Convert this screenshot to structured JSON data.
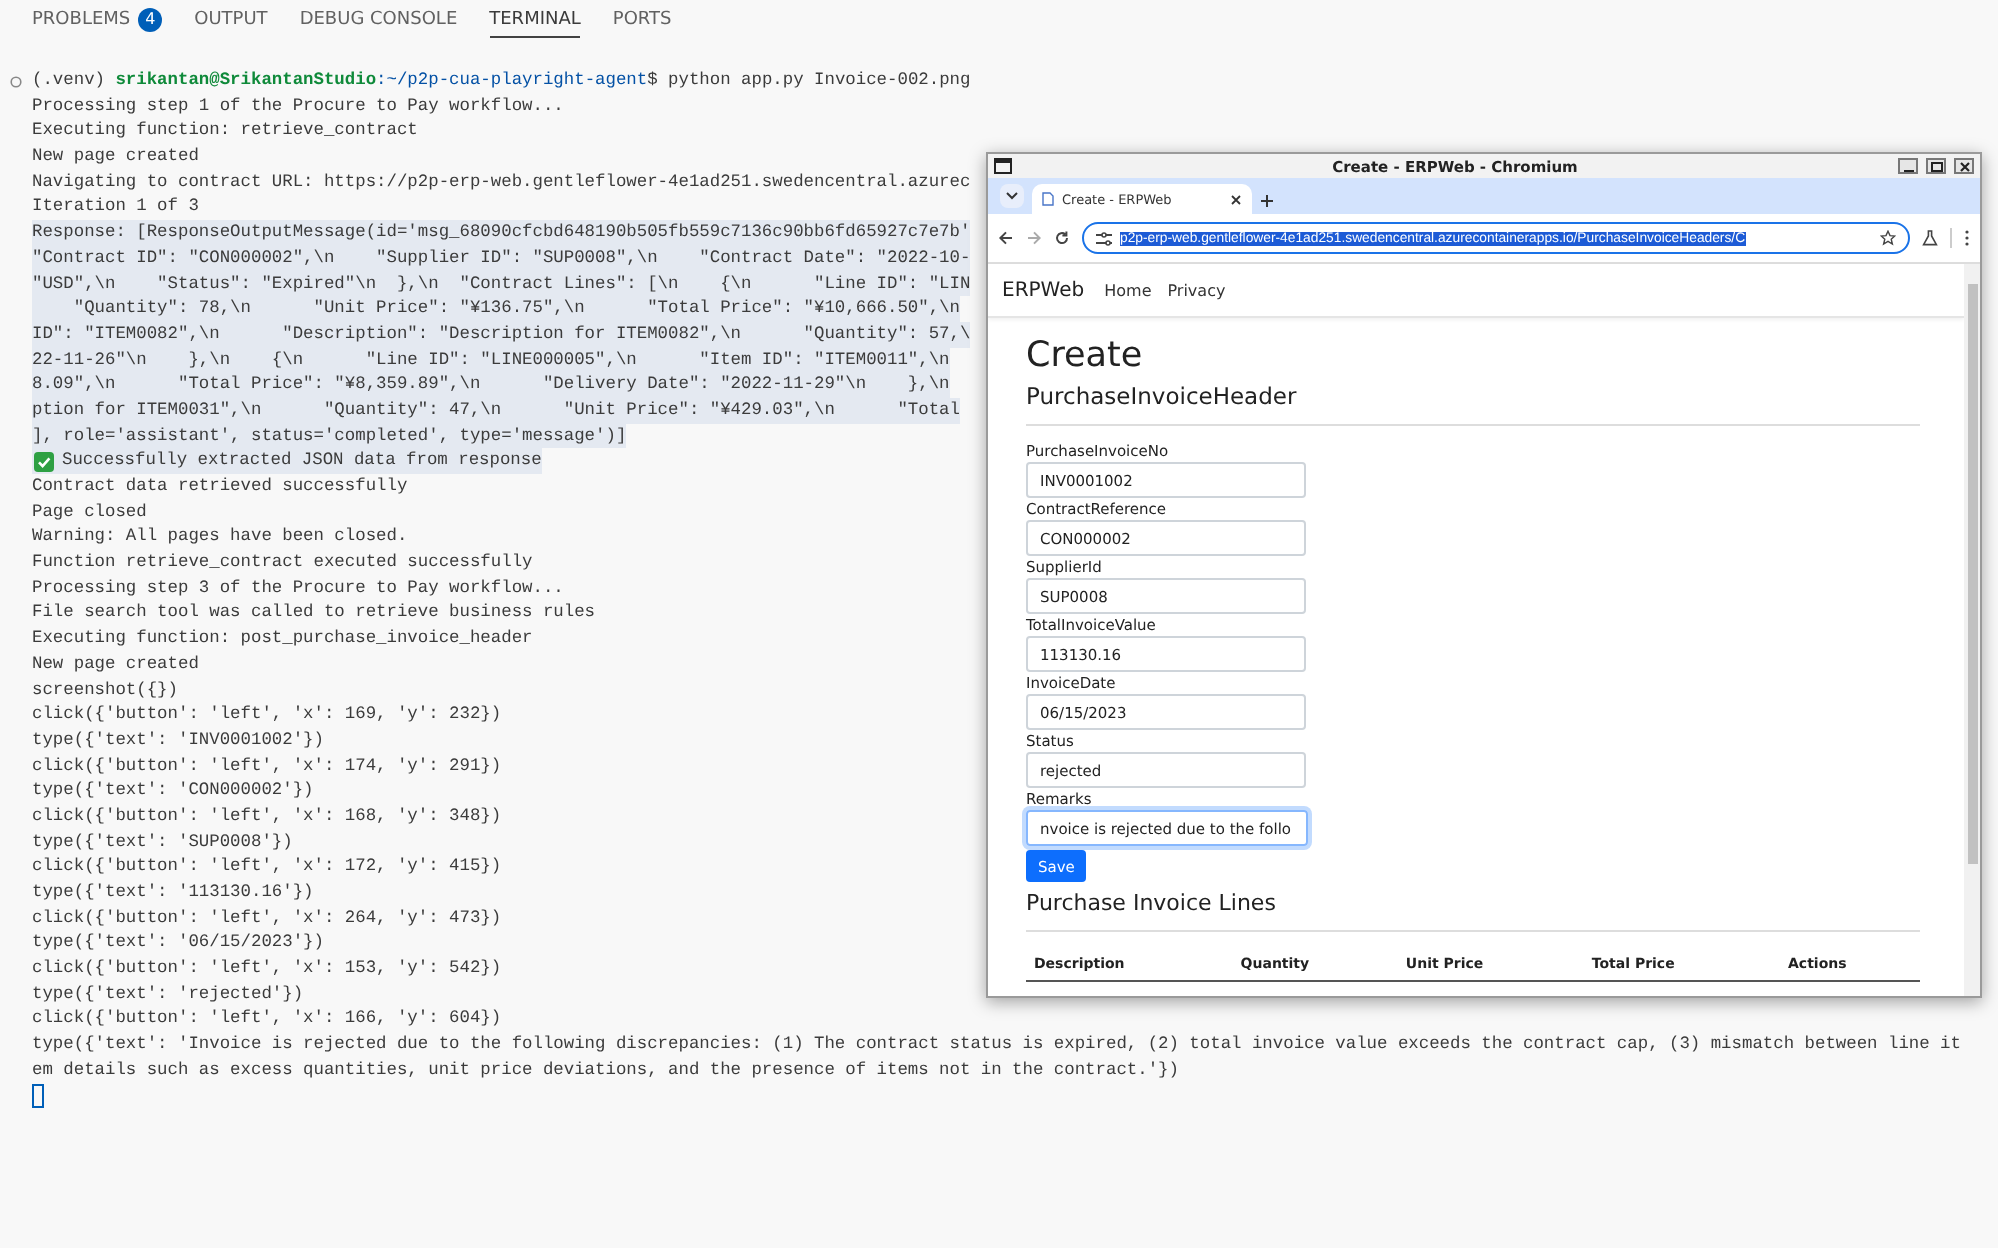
{
  "panel_tabs": [
    {
      "label": "PROBLEMS",
      "badge": "4",
      "selected": false
    },
    {
      "label": "OUTPUT",
      "selected": false
    },
    {
      "label": "DEBUG CONSOLE",
      "selected": false
    },
    {
      "label": "TERMINAL",
      "selected": true
    },
    {
      "label": "PORTS",
      "selected": false
    }
  ],
  "terminal": {
    "lines": [
      {
        "kind": "prompt",
        "venv": "(.venv)",
        "user": "srikantan@SrikantanStudio",
        "path": ":~/p2p-cua-playright-agent",
        "command": "$ python app.py Invoice-002.png",
        "highlighted": false
      },
      {
        "kind": "text",
        "text": "Processing step 1 of the Procure to Pay workflow...",
        "highlighted": false
      },
      {
        "kind": "text",
        "text": "Executing function: retrieve_contract",
        "highlighted": false
      },
      {
        "kind": "text",
        "text": "New page created",
        "highlighted": false
      },
      {
        "kind": "text",
        "text": "Navigating to contract URL: https://p2p-erp-web.gentleflower-4e1ad251.swedencentral.azurec",
        "highlighted": false
      },
      {
        "kind": "text",
        "text": "Iteration 1 of 3",
        "highlighted": false
      },
      {
        "kind": "text",
        "text": "Response: [ResponseOutputMessage(id='msg_68090cfcbd648190b505fb559c7136c90bb6fd65927c7e7b'",
        "highlighted": true
      },
      {
        "kind": "text",
        "text": "\"Contract ID\": \"CON000002\",\\n    \"Supplier ID\": \"SUP0008\",\\n    \"Contract Date\": \"2022-10-",
        "highlighted": true
      },
      {
        "kind": "text",
        "text": "\"USD\",\\n    \"Status\": \"Expired\"\\n  },\\n  \"Contract Lines\": [\\n    {\\n      \"Line ID\": \"LIN",
        "highlighted": true
      },
      {
        "kind": "text",
        "text": "    \"Quantity\": 78,\\n      \"Unit Price\": \"¥136.75\",\\n      \"Total Price\": \"¥10,666.50\",\\n",
        "highlighted": true
      },
      {
        "kind": "text",
        "text": "ID\": \"ITEM0082\",\\n      \"Description\": \"Description for ITEM0082\",\\n      \"Quantity\": 57,\\",
        "highlighted": true
      },
      {
        "kind": "text",
        "text": "22-11-26\"\\n    },\\n    {\\n      \"Line ID\": \"LINE000005\",\\n      \"Item ID\": \"ITEM0011\",\\n",
        "highlighted": true
      },
      {
        "kind": "text",
        "text": "8.09\",\\n      \"Total Price\": \"¥8,359.89\",\\n      \"Delivery Date\": \"2022-11-29\"\\n    },\\n",
        "highlighted": true
      },
      {
        "kind": "text",
        "text": "ption for ITEM0031\",\\n      \"Quantity\": 47,\\n      \"Unit Price\": \"¥429.03\",\\n      \"Total",
        "highlighted": true
      },
      {
        "kind": "text",
        "text": "], role='assistant', status='completed', type='message')]",
        "highlighted": true
      },
      {
        "kind": "check",
        "text": "Successfully extracted JSON data from response",
        "highlighted": true
      },
      {
        "kind": "text",
        "text": "Contract data retrieved successfully",
        "highlighted": false
      },
      {
        "kind": "text",
        "text": "Page closed",
        "highlighted": false
      },
      {
        "kind": "text",
        "text": "Warning: All pages have been closed.",
        "highlighted": false
      },
      {
        "kind": "text",
        "text": "Function retrieve_contract executed successfully",
        "highlighted": false
      },
      {
        "kind": "text",
        "text": "Processing step 3 of the Procure to Pay workflow...",
        "highlighted": false
      },
      {
        "kind": "text",
        "text": "File search tool was called to retrieve business rules",
        "highlighted": false
      },
      {
        "kind": "text",
        "text": "Executing function: post_purchase_invoice_header",
        "highlighted": false
      },
      {
        "kind": "text",
        "text": "New page created",
        "highlighted": false
      },
      {
        "kind": "text",
        "text": "screenshot({})",
        "highlighted": false
      },
      {
        "kind": "text",
        "text": "click({'button': 'left', 'x': 169, 'y': 232})",
        "highlighted": false
      },
      {
        "kind": "text",
        "text": "type({'text': 'INV0001002'})",
        "highlighted": false
      },
      {
        "kind": "text",
        "text": "click({'button': 'left', 'x': 174, 'y': 291})",
        "highlighted": false
      },
      {
        "kind": "text",
        "text": "type({'text': 'CON000002'})",
        "highlighted": false
      },
      {
        "kind": "text",
        "text": "click({'button': 'left', 'x': 168, 'y': 348})",
        "highlighted": false
      },
      {
        "kind": "text",
        "text": "type({'text': 'SUP0008'})",
        "highlighted": false
      },
      {
        "kind": "text",
        "text": "click({'button': 'left', 'x': 172, 'y': 415})",
        "highlighted": false
      },
      {
        "kind": "text",
        "text": "type({'text': '113130.16'})",
        "highlighted": false
      },
      {
        "kind": "text",
        "text": "click({'button': 'left', 'x': 264, 'y': 473})",
        "highlighted": false
      },
      {
        "kind": "text",
        "text": "type({'text': '06/15/2023'})",
        "highlighted": false
      },
      {
        "kind": "text",
        "text": "click({'button': 'left', 'x': 153, 'y': 542})",
        "highlighted": false
      },
      {
        "kind": "text",
        "text": "type({'text': 'rejected'})",
        "highlighted": false
      },
      {
        "kind": "text",
        "text": "click({'button': 'left', 'x': 166, 'y': 604})",
        "highlighted": false
      },
      {
        "kind": "text",
        "text": "type({'text': 'Invoice is rejected due to the following discrepancies: (1) The contract status is expired, (2) total invoice value exceeds the contract cap, (3) mismatch between line it",
        "highlighted": false
      },
      {
        "kind": "text",
        "text": "em details such as excess quantities, unit price deviations, and the presence of items not in the contract.'})",
        "highlighted": false
      },
      {
        "kind": "cursor",
        "highlighted": false
      }
    ]
  },
  "browser": {
    "title": "Create - ERPWeb - Chromium",
    "tabs": [
      {
        "label": "Create - ERPWeb",
        "selected": true
      }
    ],
    "url": {
      "value": "p2p-erp-web.gentleflower-4e1ad251.swedencentral.azurecontainerapps.io/PurchaseInvoiceHeaders/C",
      "selected": true
    },
    "page": {
      "brand": "ERPWeb",
      "nav": [
        "Home",
        "Privacy"
      ],
      "heading": "Create",
      "subheading": "PurchaseInvoiceHeader",
      "fields": [
        {
          "label": "PurchaseInvoiceNo",
          "value": "INV0001002",
          "focused": false
        },
        {
          "label": "ContractReference",
          "value": "CON000002",
          "focused": false
        },
        {
          "label": "SupplierId",
          "value": "SUP0008",
          "focused": false
        },
        {
          "label": "TotalInvoiceValue",
          "value": "113130.16",
          "focused": false
        },
        {
          "label": "InvoiceDate",
          "value": "06/15/2023",
          "focused": false
        },
        {
          "label": "Status",
          "value": "rejected",
          "focused": false
        },
        {
          "label": "Remarks",
          "value": "nvoice is rejected due to the follo",
          "focused": true
        }
      ],
      "save_button": "Save",
      "lines_heading": "Purchase Invoice Lines",
      "table": {
        "columns": [
          "Description",
          "Quantity",
          "Unit Price",
          "Total Price",
          "Actions"
        ]
      }
    }
  }
}
